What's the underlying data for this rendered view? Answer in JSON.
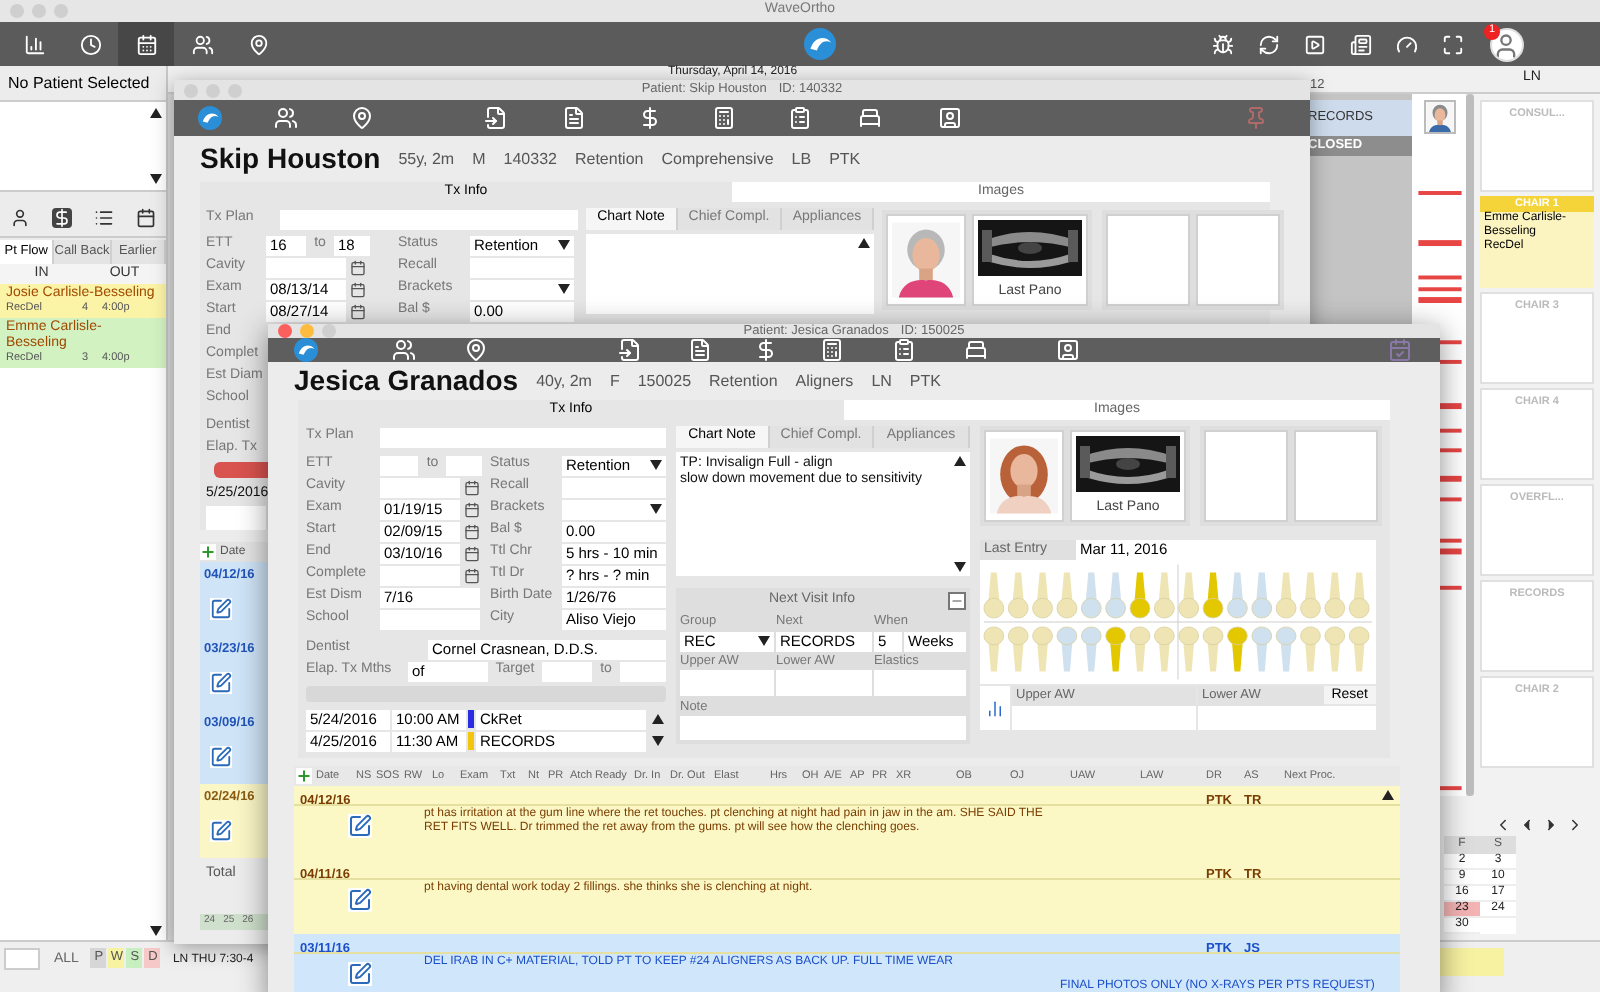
{
  "app": {
    "title": "WaveOrtho",
    "notifications": "1",
    "nav": [
      {
        "selected": false
      },
      {
        "selected": false
      },
      {
        "selected": true
      },
      {
        "selected": false
      },
      {
        "selected": false
      }
    ]
  },
  "sidebar": {
    "patient": "No Patient Selected",
    "tabs": [
      {
        "label": "Pt Flow",
        "selected": true
      },
      {
        "label": "Call Back",
        "selected": false
      },
      {
        "label": "Earlier",
        "selected": false
      }
    ],
    "columns": [
      "IN",
      "OUT"
    ],
    "flow": [
      {
        "name": "Josie  Carlisle-Besseling",
        "appointment": "RecDel",
        "chair": "4",
        "time": "4:00p",
        "color": "#fbf3a6"
      },
      {
        "name": "Emme Carlisle-Besseling",
        "appointment": "RecDel",
        "chair": "3",
        "time": "4:00p",
        "color": "#d3f2c2"
      }
    ]
  },
  "bottom_bar": {
    "filter": "ALL",
    "chips": [
      {
        "label": "P",
        "color": "#d6d6d6"
      },
      {
        "label": "W",
        "color": "#f7f3a0"
      },
      {
        "label": "S",
        "color": "#c8efc0"
      },
      {
        "label": "D",
        "color": "#f6c8c8"
      }
    ],
    "provider_day": "LN THU 7:30-4"
  },
  "schedule": {
    "date": "Thursday, April 14, 2016",
    "hour": "12",
    "provider": "LN",
    "appointments": [
      {
        "label": "RECORDS",
        "kind": "appointment"
      },
      {
        "label": "CLOSED",
        "kind": "closed"
      }
    ]
  },
  "chairs": [
    {
      "name": "CONSUL...",
      "kind": "empty"
    },
    {
      "name": "CHAIR 1",
      "kind": "occupied",
      "patient": "Emme Carlisle-Besseling",
      "appointment": "RecDel"
    },
    {
      "name": "CHAIR 3",
      "kind": "empty"
    },
    {
      "name": "CHAIR 4",
      "kind": "empty"
    },
    {
      "name": "OVERFL...",
      "kind": "empty"
    },
    {
      "name": "RECORDS",
      "kind": "empty"
    },
    {
      "name": "CHAIR 2",
      "kind": "empty"
    }
  ],
  "calendar": {
    "headers": [
      "F",
      "S"
    ],
    "days": [
      {
        "day": "2",
        "marked": false
      },
      {
        "day": "3",
        "marked": false
      },
      {
        "day": "9",
        "marked": false
      },
      {
        "day": "10",
        "marked": false
      },
      {
        "day": "16",
        "marked": false
      },
      {
        "day": "17",
        "marked": false
      },
      {
        "day": "23",
        "marked": true
      },
      {
        "day": "24",
        "marked": false
      },
      {
        "day": "30",
        "marked": false
      }
    ]
  },
  "back_window": {
    "title": "Patient: Skip Houston",
    "id": "ID: 140332",
    "name": "Skip Houston",
    "details": [
      "55y, 2m",
      "M",
      "140332",
      "Retention",
      "Comprehensive",
      "LB",
      "PTK"
    ],
    "tabs": [
      {
        "label": "Tx Info",
        "selected": true
      },
      {
        "label": "Images",
        "selected": false
      }
    ],
    "tx_plan": "Tx Plan",
    "dates": [
      {
        "label": "ETT",
        "kind": "range",
        "value": "16",
        "to_label": "to",
        "to_value": "18"
      },
      {
        "label": "Cavity",
        "kind": "date"
      },
      {
        "label": "Exam",
        "kind": "date",
        "value": "08/13/14"
      },
      {
        "label": "Start",
        "kind": "date",
        "value": "08/27/14"
      },
      {
        "label": "End",
        "kind": "label"
      },
      {
        "label": "Complet",
        "kind": "label"
      },
      {
        "label": "Est Diam",
        "kind": "label"
      },
      {
        "label": "School",
        "kind": "label"
      }
    ],
    "status": [
      {
        "label": "Status",
        "kind": "select",
        "value": "Retention"
      },
      {
        "label": "Recall",
        "kind": "text"
      },
      {
        "label": "Brackets",
        "kind": "select"
      },
      {
        "label": "Bal $",
        "kind": "text",
        "value": "0.00"
      }
    ],
    "dentist": "Dentist",
    "elapsed": "Elap. Tx",
    "next_date": "5/25/2016",
    "chart_tabs": [
      {
        "label": "Chart Note",
        "selected": true
      },
      {
        "label": "Chief Compl.",
        "selected": false
      },
      {
        "label": "Appliances",
        "selected": false
      }
    ],
    "image_caption": "Last Pano",
    "notes": {
      "header": "Date",
      "entries": [
        {
          "date": "04/12/16",
          "kind": "visit"
        },
        {
          "date": "03/23/16",
          "kind": "visit"
        },
        {
          "date": "03/09/16",
          "kind": "visit"
        },
        {
          "date": "02/24/16",
          "kind": "other"
        }
      ],
      "total": "Total"
    },
    "week_days": [
      "24",
      "25",
      "26"
    ]
  },
  "front_window": {
    "title": "Patient: Jesica Granados",
    "id": "ID: 150025",
    "name": "Jesica Granados",
    "details": [
      "40y, 2m",
      "F",
      "150025",
      "Retention",
      "Aligners",
      "LN",
      "PTK"
    ],
    "tabs": [
      {
        "label": "Tx Info",
        "selected": true
      },
      {
        "label": "Images",
        "selected": false
      }
    ],
    "tx_plan": "Tx Plan",
    "dates": [
      {
        "label": "ETT",
        "kind": "range",
        "to_label": "to"
      },
      {
        "label": "Cavity",
        "kind": "date"
      },
      {
        "label": "Exam",
        "kind": "date",
        "value": "01/19/15"
      },
      {
        "label": "Start",
        "kind": "date",
        "value": "02/09/15"
      },
      {
        "label": "End",
        "kind": "date",
        "value": "03/10/16"
      },
      {
        "label": "Complete",
        "kind": "date"
      },
      {
        "label": "Est Dism",
        "kind": "text",
        "value": "7/16"
      },
      {
        "label": "School",
        "kind": "text"
      }
    ],
    "status": [
      {
        "label": "Status",
        "kind": "select",
        "value": "Retention"
      },
      {
        "label": "Recall",
        "kind": "text"
      },
      {
        "label": "Brackets",
        "kind": "select"
      },
      {
        "label": "Bal $",
        "kind": "text",
        "value": "0.00"
      },
      {
        "label": "Ttl Chr",
        "kind": "text",
        "value": "5 hrs - 10 min"
      },
      {
        "label": "Ttl Dr",
        "kind": "text",
        "value": "? hrs - ? min"
      },
      {
        "label": "Birth Date",
        "kind": "text",
        "value": "1/26/76"
      },
      {
        "label": "City",
        "kind": "text",
        "value": "Aliso Viejo"
      }
    ],
    "dentist": {
      "label": "Dentist",
      "value": "Cornel Crasnean, D.D.S."
    },
    "elapsed": {
      "label": "Elap. Tx Mths",
      "value": "of",
      "target_label": "Target",
      "to_label": "to"
    },
    "appointments": [
      {
        "date": "5/24/2016",
        "time": "10:00 AM",
        "color": "#2a2ee0",
        "type": "CkRet"
      },
      {
        "date": "4/25/2016",
        "time": "11:30 AM",
        "color": "#f3c50f",
        "type": "RECORDS"
      }
    ],
    "chart_tabs": [
      {
        "label": "Chart Note",
        "selected": true
      },
      {
        "label": "Chief Compl.",
        "selected": false
      },
      {
        "label": "Appliances",
        "selected": false
      }
    ],
    "chart_note": [
      "TP: Invisalign Full - align",
      "slow down movement due to sensitivity"
    ],
    "next_visit": {
      "title": "Next Visit Info",
      "group_label": "Group",
      "group": "REC",
      "next_label": "Next",
      "next": "RECORDS",
      "when_label": "When",
      "when": "5",
      "unit": "Weeks",
      "upper_label": "Upper AW",
      "lower_label": "Lower AW",
      "elastics_label": "Elastics",
      "note_label": "Note"
    },
    "image_caption": "Last Pano",
    "last_entry": {
      "label": "Last Entry",
      "value": "Mar 11, 2016"
    },
    "wires": {
      "upper_label": "Upper AW",
      "lower_label": "Lower AW",
      "reset": "Reset"
    },
    "progress": {
      "columns": [
        "Date",
        "NS",
        "SOS",
        "RW",
        "Lo",
        "Exam",
        "Txt",
        "Nt",
        "PR",
        "Atch Ready",
        "Dr. In",
        "Dr. Out",
        "Elast",
        "Hrs",
        "OH",
        "A/E",
        "AP",
        "PR",
        "XR",
        "OB",
        "OJ",
        "UAW",
        "LAW",
        "DR",
        "AS",
        "Next Proc."
      ],
      "rows": [
        {
          "date": "04/12/16",
          "kind": "entry",
          "note": "pt has irritation at the gum line where the ret touches.  pt clenching at night had pain in jaw in the am. SHE SAID THE RET FITS WELL.   Dr trimmed the ret away from the gums.  pt will see how the clenching goes.",
          "dr": "PTK",
          "as": "TR"
        },
        {
          "date": "04/11/16",
          "kind": "entry",
          "note": "pt having dental work today  2 fillings.  she thinks she is clenching at night.",
          "dr": "PTK",
          "as": "TR"
        },
        {
          "date": "03/11/16",
          "kind": "highlight",
          "note": "DEL IRAB IN C+ MATERIAL, TOLD PT TO KEEP #24 ALIGNERS AS BACK UP. FULL TIME WEAR",
          "extra": "FINAL PHOTOS ONLY (NO X-RAYS PER PTS REQUEST)",
          "dr": "PTK",
          "as": "JS"
        }
      ]
    }
  }
}
